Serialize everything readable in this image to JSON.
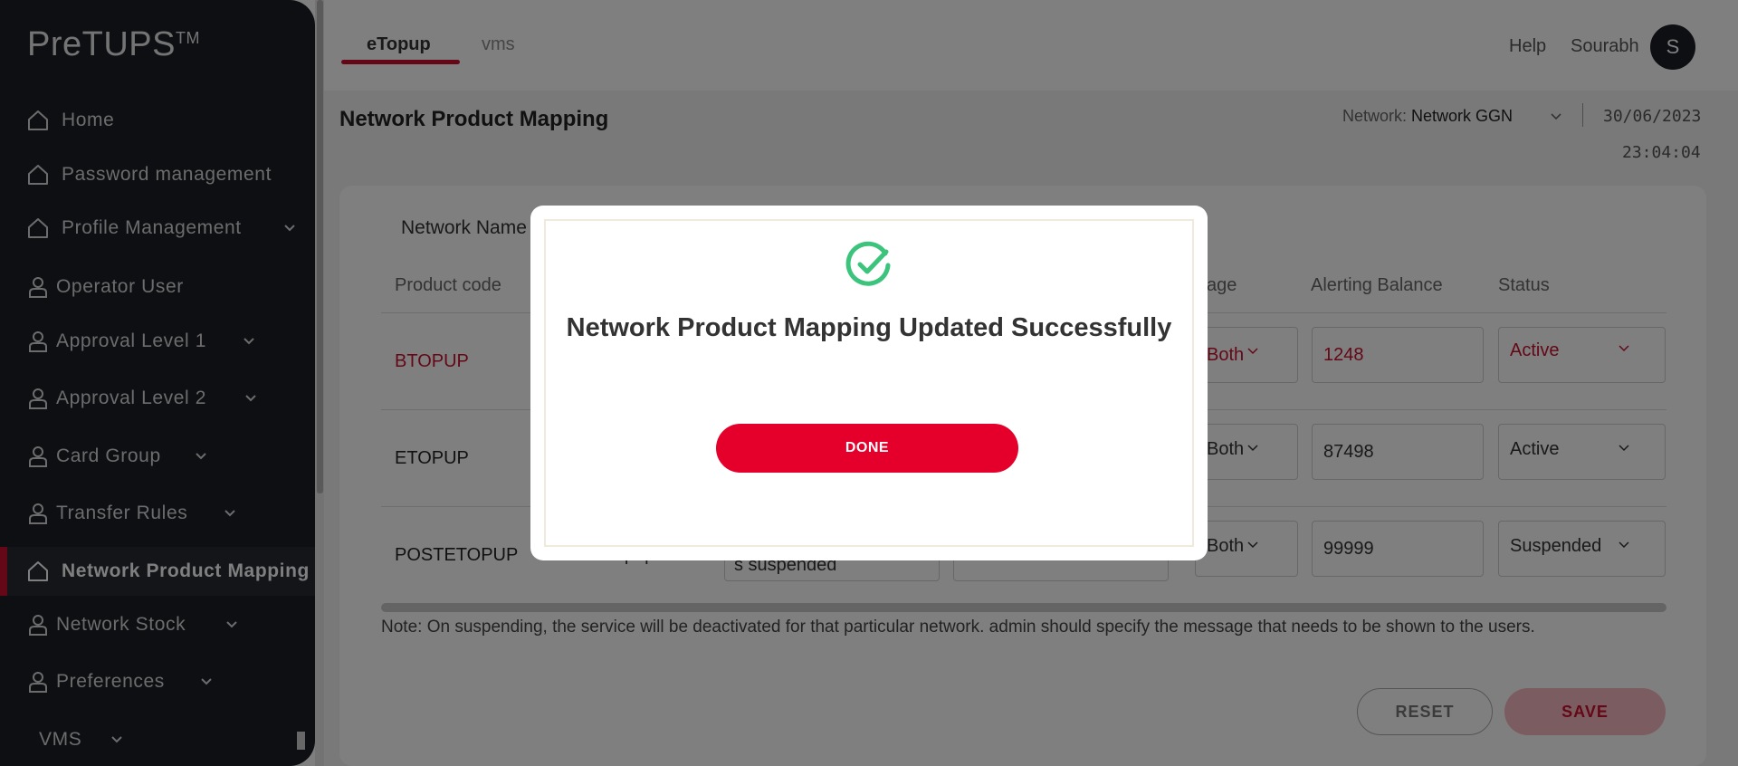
{
  "sidebar": {
    "logo": "PreTUPS",
    "logo_tm": "TM",
    "items": [
      {
        "label": "Home",
        "icon": "home-icon"
      },
      {
        "label": "Password management",
        "icon": "home-icon"
      },
      {
        "label": "Profile Management",
        "icon": "home-icon"
      },
      {
        "label": "Operator User",
        "icon": "user-icon"
      },
      {
        "label": "Approval Level 1",
        "icon": "user-icon"
      },
      {
        "label": "Approval Level 2",
        "icon": "user-icon"
      },
      {
        "label": "Card Group",
        "icon": "user-icon"
      },
      {
        "label": "Transfer Rules",
        "icon": "user-icon"
      },
      {
        "label": "Network Product Mapping",
        "icon": "home-icon"
      },
      {
        "label": "Network Stock",
        "icon": "user-icon"
      },
      {
        "label": "Preferences",
        "icon": "user-icon"
      },
      {
        "label": "VMS"
      }
    ]
  },
  "header": {
    "tabs": [
      "eTopup",
      "vms"
    ],
    "help": "Help",
    "user": "Sourabh",
    "avatar_initial": "S"
  },
  "page": {
    "title": "Network Product Mapping",
    "network_label": "Network:",
    "network_value": "Network GGN",
    "date": "30/06/2023",
    "time": "23:04:04",
    "network_name_label": "Network Name"
  },
  "table": {
    "headers": [
      "Product code",
      "age",
      "Alerting Balance",
      "Status"
    ],
    "rows": [
      {
        "code": "BTOPUP",
        "usage": "Both",
        "alerting_balance": "1248",
        "status": "Active"
      },
      {
        "code": "ETOPUP",
        "usage": "Both",
        "alerting_balance": "87498",
        "status": "Active"
      },
      {
        "code": "POSTETOPUP",
        "partial_name": "Post eTopup",
        "message": "s suspended",
        "usage": "Both",
        "alerting_balance": "99999",
        "status": "Suspended"
      }
    ]
  },
  "note": "Note: On suspending, the service will be deactivated for that particular network. admin should specify the message that needs to be shown to the users.",
  "buttons": {
    "reset": "RESET",
    "save": "SAVE"
  },
  "modal": {
    "title": "Network Product Mapping Updated Successfully",
    "done": "DONE",
    "icon": "check-circle-icon",
    "icon_color": "#3cc47c"
  },
  "colors": {
    "accent": "#c8102e",
    "sidebar": "#1b1f26",
    "done": "#e4002b"
  }
}
